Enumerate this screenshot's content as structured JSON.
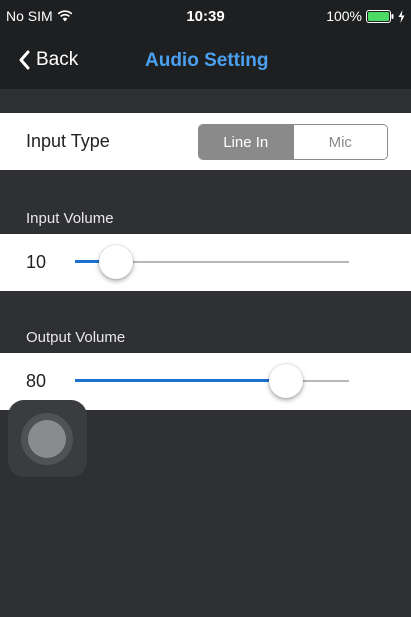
{
  "status_bar": {
    "carrier": "No SIM",
    "time": "10:39",
    "battery": "100%"
  },
  "nav": {
    "back_label": "Back",
    "title": "Audio Setting"
  },
  "input_type": {
    "label": "Input Type",
    "options": [
      "Line In",
      "Mic"
    ],
    "selected": "Line In"
  },
  "input_volume": {
    "header": "Input Volume",
    "value": "10",
    "level": 0.15
  },
  "output_volume": {
    "header": "Output Volume",
    "value": "80",
    "level": 0.77
  },
  "colors": {
    "accent": "#4aa0ee",
    "slider_fill": "#1d72d1",
    "background": "#2f3033",
    "bar_background": "#1e1f21"
  },
  "icons": {
    "wifi": "wifi-icon",
    "battery": "battery-icon",
    "charging": "charging-bolt-icon",
    "back": "chevron-left-icon",
    "assistive_touch": "assistive-touch-icon"
  }
}
